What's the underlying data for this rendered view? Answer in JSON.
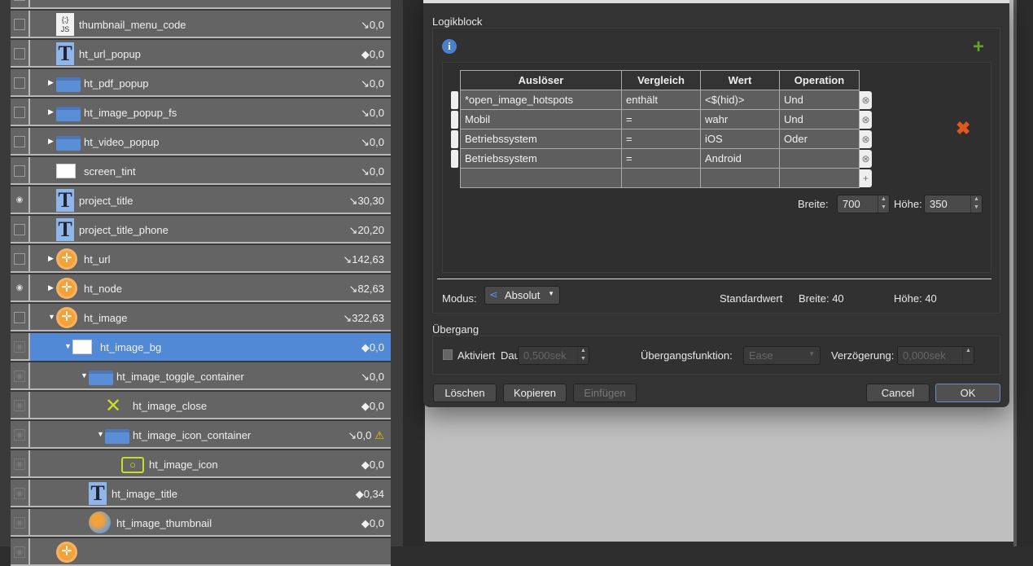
{
  "tree": {
    "rows": [
      {
        "name": "",
        "value": "",
        "symbol": "",
        "vis": "box",
        "level": 2,
        "icon": "red-circle",
        "exp": ""
      },
      {
        "name": "thumbnail_menu_code",
        "value": "0,0",
        "symbol": "↘",
        "vis": "box",
        "level": 0,
        "icon": "js",
        "exp": ""
      },
      {
        "name": "ht_url_popup",
        "value": "0,0",
        "symbol": "◆",
        "vis": "box",
        "level": 0,
        "icon": "text",
        "exp": ""
      },
      {
        "name": "ht_pdf_popup",
        "value": "0,0",
        "symbol": "↘",
        "vis": "box",
        "level": 0,
        "icon": "folder",
        "exp": "▶"
      },
      {
        "name": "ht_image_popup_fs",
        "value": "0,0",
        "symbol": "↘",
        "vis": "box",
        "level": 0,
        "icon": "folder",
        "exp": "▶"
      },
      {
        "name": "ht_video_popup",
        "value": "0,0",
        "symbol": "↘",
        "vis": "box",
        "level": 0,
        "icon": "folder",
        "exp": "▶"
      },
      {
        "name": "screen_tint",
        "value": "0,0",
        "symbol": "↘",
        "vis": "box",
        "level": 0,
        "icon": "rect",
        "exp": ""
      },
      {
        "name": "project_title",
        "value": "30,30",
        "symbol": "↘",
        "vis": "eye",
        "level": 0,
        "icon": "text",
        "exp": ""
      },
      {
        "name": "project_title_phone",
        "value": "20,20",
        "symbol": "↘",
        "vis": "box",
        "level": 0,
        "icon": "text",
        "exp": ""
      },
      {
        "name": "ht_url",
        "value": "142,63",
        "symbol": "↘",
        "vis": "box",
        "level": 0,
        "icon": "hotspot",
        "exp": "▶"
      },
      {
        "name": "ht_node",
        "value": "82,63",
        "symbol": "↘",
        "vis": "eye",
        "level": 0,
        "icon": "hotspot",
        "exp": "▶"
      },
      {
        "name": "ht_image",
        "value": "322,63",
        "symbol": "↘",
        "vis": "box",
        "level": 0,
        "icon": "hotspot",
        "exp": "▼"
      },
      {
        "name": "ht_image_bg",
        "value": "0,0",
        "symbol": "◆",
        "vis": "dim",
        "level": 1,
        "icon": "rect",
        "exp": "▼",
        "selected": true
      },
      {
        "name": "ht_image_toggle_container",
        "value": "0,0",
        "symbol": "↘",
        "vis": "dim",
        "level": 2,
        "icon": "folder",
        "exp": "▼"
      },
      {
        "name": "ht_image_close",
        "value": "0,0",
        "symbol": "◆",
        "vis": "dim",
        "level": 3,
        "icon": "close",
        "exp": ""
      },
      {
        "name": "ht_image_icon_container",
        "value": "0,0",
        "symbol": "↘",
        "vis": "dim",
        "level": 3,
        "icon": "folder",
        "exp": "▼",
        "warning": true
      },
      {
        "name": "ht_image_icon",
        "value": "0,0",
        "symbol": "◆",
        "vis": "dim",
        "level": 4,
        "icon": "camera",
        "exp": ""
      },
      {
        "name": "ht_image_title",
        "value": "0,34",
        "symbol": "◆",
        "vis": "dim",
        "level": 2,
        "icon": "text",
        "exp": ""
      },
      {
        "name": "ht_image_thumbnail",
        "value": "0,0",
        "symbol": "◆",
        "vis": "dim",
        "level": 2,
        "icon": "globe",
        "exp": ""
      },
      {
        "name": "",
        "value": "",
        "symbol": "",
        "vis": "dim",
        "level": 0,
        "icon": "hotspot",
        "exp": ""
      }
    ]
  },
  "dialog": {
    "logic_title": "Logikblock",
    "table": {
      "headers": [
        "Auslöser",
        "Vergleich",
        "Wert",
        "Operation"
      ],
      "rows": [
        [
          "*open_image_hotspots",
          "enthält",
          "<$(hid)>",
          "Und"
        ],
        [
          "Mobil",
          "=",
          "wahr",
          "Und"
        ],
        [
          "Betriebssystem",
          "=",
          "iOS",
          "Oder"
        ],
        [
          "Betriebssystem",
          "=",
          "Android",
          ""
        ],
        [
          "",
          "",
          "",
          ""
        ]
      ]
    },
    "breite_label": "Breite:",
    "breite_value": "700",
    "hoehe_label": "Höhe:",
    "hoehe_value": "350",
    "modus_label": "Modus:",
    "modus_value": "Absolut",
    "standard_label": "Standardwert",
    "std_breite_label": "Breite:",
    "std_breite": "40",
    "std_hoehe_label": "Höhe:",
    "std_hoehe": "40",
    "transition_title": "Übergang",
    "aktiviert": "Aktiviert",
    "dauer_label": "Dauer:",
    "dauer_value": "0,500sek",
    "func_label": "Übergangsfunktion:",
    "func_value": "Ease",
    "delay_label": "Verzögerung:",
    "delay_value": "0,000sek",
    "buttons": {
      "delete": "Löschen",
      "copy": "Kopieren",
      "paste": "Einfügen",
      "cancel": "Cancel",
      "ok": "OK"
    }
  },
  "colors": {
    "selection": "#5289d6",
    "add": "#5fa52a",
    "remove": "#e0581c",
    "warning": "#f5c400"
  }
}
